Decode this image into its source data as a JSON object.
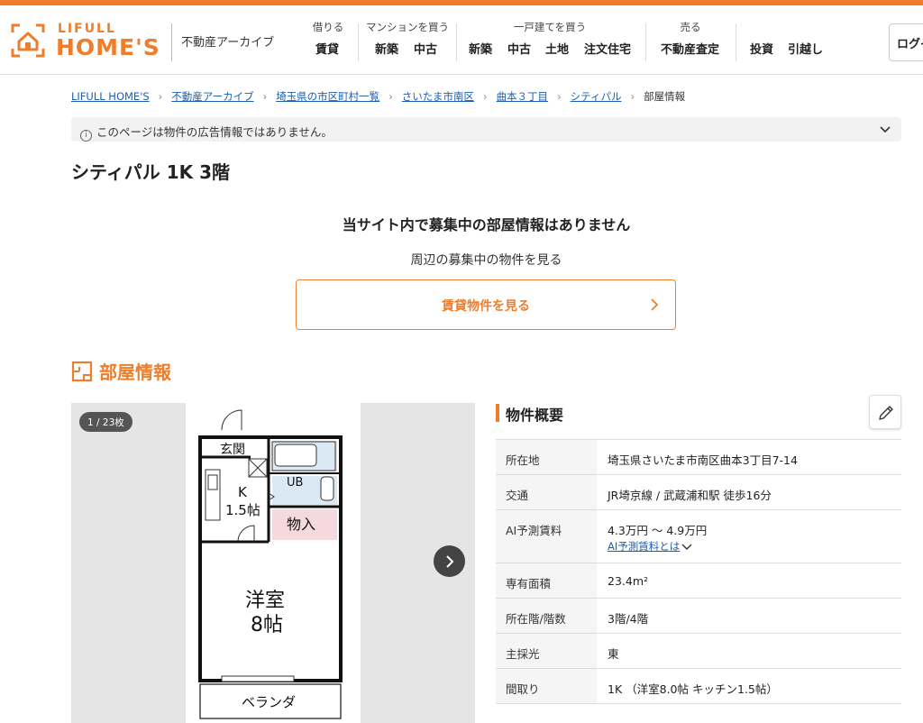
{
  "header": {
    "logo_small": "LIFULL",
    "logo_big": "HOME'S",
    "archive": "不動産アーカイブ",
    "nav": [
      {
        "category": "借りる",
        "items": [
          "賃貸"
        ]
      },
      {
        "category": "マンションを買う",
        "items": [
          "新築",
          "中古"
        ]
      },
      {
        "category": "一戸建てを買う",
        "items": [
          "新築",
          "中古",
          "土地",
          "注文住宅"
        ]
      },
      {
        "category": "売る",
        "items": [
          "不動産査定"
        ]
      },
      {
        "category": "",
        "items": [
          "投資",
          "引越し"
        ]
      }
    ],
    "login": "ログイ"
  },
  "breadcrumb": [
    "LIFULL HOME'S",
    "不動産アーカイブ",
    "埼玉県の市区町村一覧",
    "さいたま市南区",
    "曲本３丁目",
    "シティパル",
    "部屋情報"
  ],
  "notice": "このページは物件の広告情報ではありません。",
  "title": "シティパル 1K 3階",
  "no_listing": "当サイト内で募集中の部屋情報はありません",
  "nearby": "周辺の募集中の物件を見る",
  "cta": "賃貸物件を見る",
  "room_section": "部屋情報",
  "gallery": {
    "counter": "1 / 23枚",
    "plan": {
      "entrance": "玄関",
      "bath": "UB",
      "kitchen": "K",
      "kitchen_size": "1.5帖",
      "storage": "物入",
      "western": "洋室",
      "western_size": "8帖",
      "veranda": "ベランダ"
    }
  },
  "overview": {
    "title": "物件概要",
    "rows": [
      {
        "k": "所在地",
        "v": "埼玉県さいたま市南区曲本3丁目7-14"
      },
      {
        "k": "交通",
        "v": "JR埼京線 / 武蔵浦和駅 徒歩16分"
      },
      {
        "k": "AI予測賃料",
        "v": "4.3万円 〜 4.9万円",
        "link": "AI予測賃料とは"
      },
      {
        "k": "専有面積",
        "v": "23.4m²"
      },
      {
        "k": "所在階/階数",
        "v": "3階/4階"
      },
      {
        "k": "主採光",
        "v": "東"
      },
      {
        "k": "間取り",
        "v": "1K （洋室8.0帖 キッチン1.5帖）"
      }
    ]
  },
  "colors": {
    "brand": "#ee7e2c",
    "link": "#1b5fb0"
  }
}
